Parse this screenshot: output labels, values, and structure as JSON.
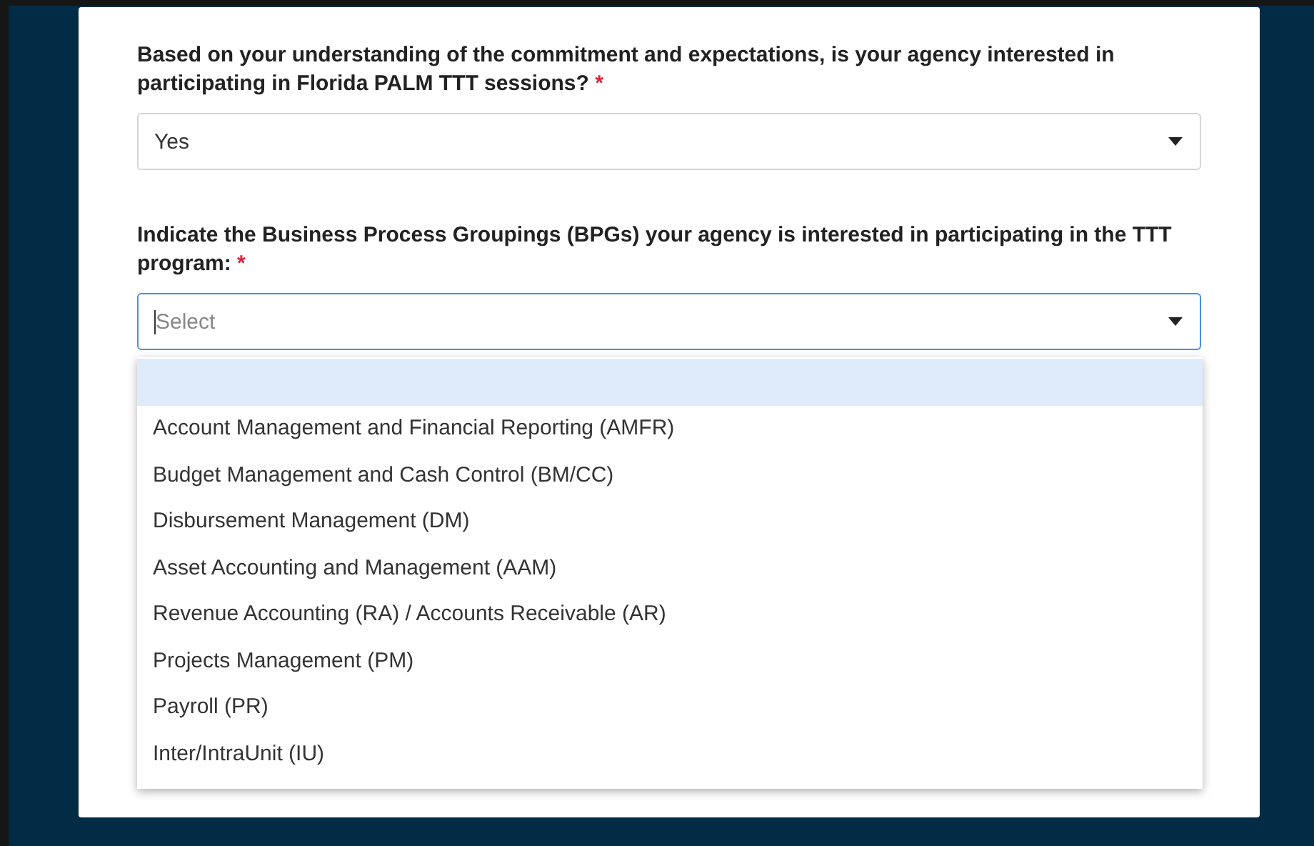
{
  "questions": [
    {
      "label": "Based on your understanding of the commitment and expectations, is your agency interested in participating in Florida PALM TTT sessions?",
      "required_mark": "*",
      "value": "Yes",
      "focused": false
    },
    {
      "label": "Indicate the Business Process Groupings (BPGs) your agency is interested in participating in the TTT program:",
      "required_mark": "*",
      "placeholder": "Select",
      "focused": true,
      "dropdown": {
        "options": [
          {
            "kind": "blank",
            "selected": true
          },
          {
            "kind": "option",
            "label": "Account Management and Financial Reporting (AMFR)",
            "selected": false
          },
          {
            "kind": "option",
            "label": "Budget Management and Cash Control (BM/CC)",
            "selected": false
          },
          {
            "kind": "option",
            "label": "Disbursement Management (DM)",
            "selected": false
          },
          {
            "kind": "option",
            "label": "Asset Accounting and Management (AAM)",
            "selected": false
          },
          {
            "kind": "option",
            "label": "Revenue Accounting (RA) / Accounts Receivable (AR)",
            "selected": false
          },
          {
            "kind": "option",
            "label": "Projects Management (PM)",
            "selected": false
          },
          {
            "kind": "option",
            "label": "Payroll (PR)",
            "selected": false
          },
          {
            "kind": "option",
            "label": "Inter/IntraUnit (IU)",
            "selected": false
          }
        ]
      }
    }
  ]
}
